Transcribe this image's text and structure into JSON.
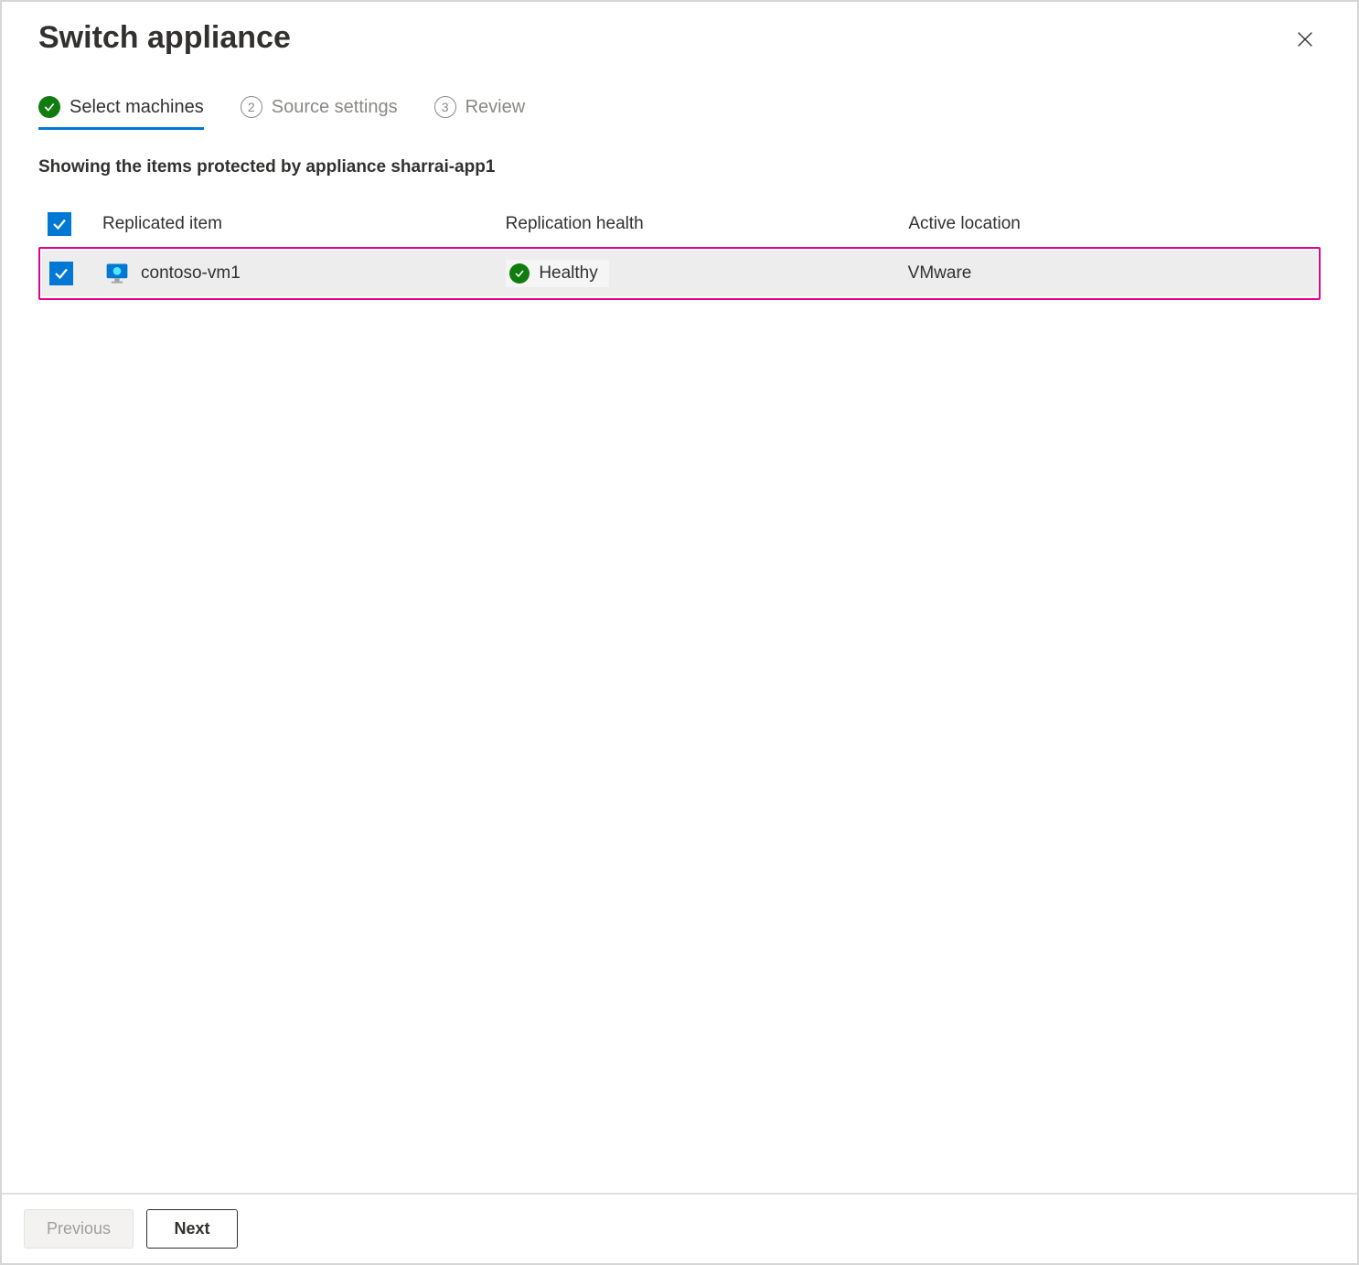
{
  "header": {
    "title": "Switch appliance"
  },
  "tabs": [
    {
      "label": "Select machines",
      "active": true,
      "completed": true
    },
    {
      "label": "Source settings",
      "active": false,
      "number": "2"
    },
    {
      "label": "Review",
      "active": false,
      "number": "3"
    }
  ],
  "subtitle": "Showing the items protected by appliance sharrai-app1",
  "table": {
    "columns": {
      "item": "Replicated item",
      "health": "Replication health",
      "location": "Active location"
    },
    "rows": [
      {
        "checked": true,
        "name": "contoso-vm1",
        "health": "Healthy",
        "location": "VMware"
      }
    ]
  },
  "footer": {
    "previous": "Previous",
    "next": "Next"
  }
}
